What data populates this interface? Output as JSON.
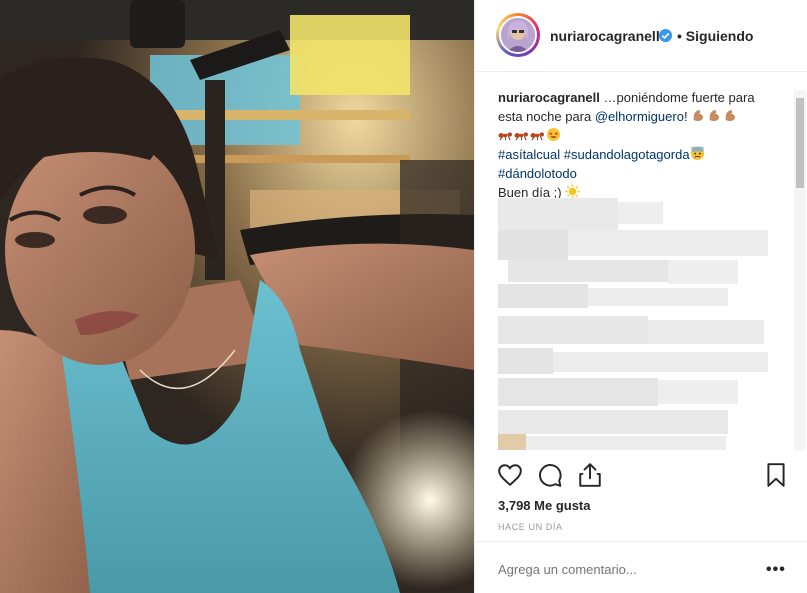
{
  "header": {
    "username": "nuriarocagranell",
    "separator": "•",
    "follow_status": "Siguiendo"
  },
  "caption": {
    "username": "nuriarocagranell",
    "text1": "…poniéndome fuerte para esta noche para",
    "mention": "@elhormiguero",
    "text2": "!",
    "hashtag1": "#asítalcual",
    "hashtag2": "#sudandolagotagorda",
    "hashtag3": "#dándolotodo",
    "greeting": "Buen día ;)"
  },
  "icons": {
    "like": "heart-icon",
    "comment": "comment-icon",
    "share": "share-icon",
    "save": "bookmark-icon",
    "verified": "verified-badge-icon",
    "more": "more-options-icon"
  },
  "stats": {
    "likes": "3,798 Me gusta",
    "time": "HACE UN DÍA"
  },
  "comment": {
    "placeholder": "Agrega un comentario...",
    "more_label": "•••"
  },
  "colors": {
    "link": "#003569",
    "verified": "#3897f0",
    "muted": "#999999",
    "tank_top": "#5fb3c2"
  }
}
